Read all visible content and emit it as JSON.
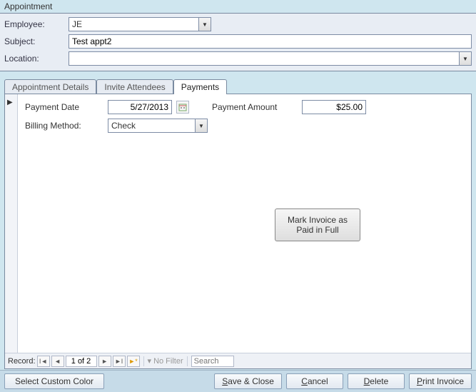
{
  "window": {
    "title": "Appointment"
  },
  "top_form": {
    "employee_label": "Employee:",
    "employee_value": "JE",
    "subject_label": "Subject:",
    "subject_value": "Test appt2",
    "location_label": "Location:",
    "location_value": ""
  },
  "tabs": {
    "details": "Appointment Details",
    "attendees": "Invite Attendees",
    "payments": "Payments",
    "active": "payments"
  },
  "payments": {
    "date_label": "Payment Date",
    "date_value": "5/27/2013",
    "amount_label": "Payment Amount",
    "amount_value": "$25.00",
    "billing_label": "Billing Method:",
    "billing_value": "Check",
    "mark_paid_button": "Mark Invoice as Paid in Full"
  },
  "record_nav": {
    "label": "Record:",
    "position": "1 of 2",
    "no_filter": "No Filter",
    "search_placeholder": "Search"
  },
  "footer": {
    "color_button": "Select Custom Color",
    "save_close": "Save & Close",
    "cancel": "Cancel",
    "delete": "Delete",
    "print_invoice": "Print Invoice"
  }
}
